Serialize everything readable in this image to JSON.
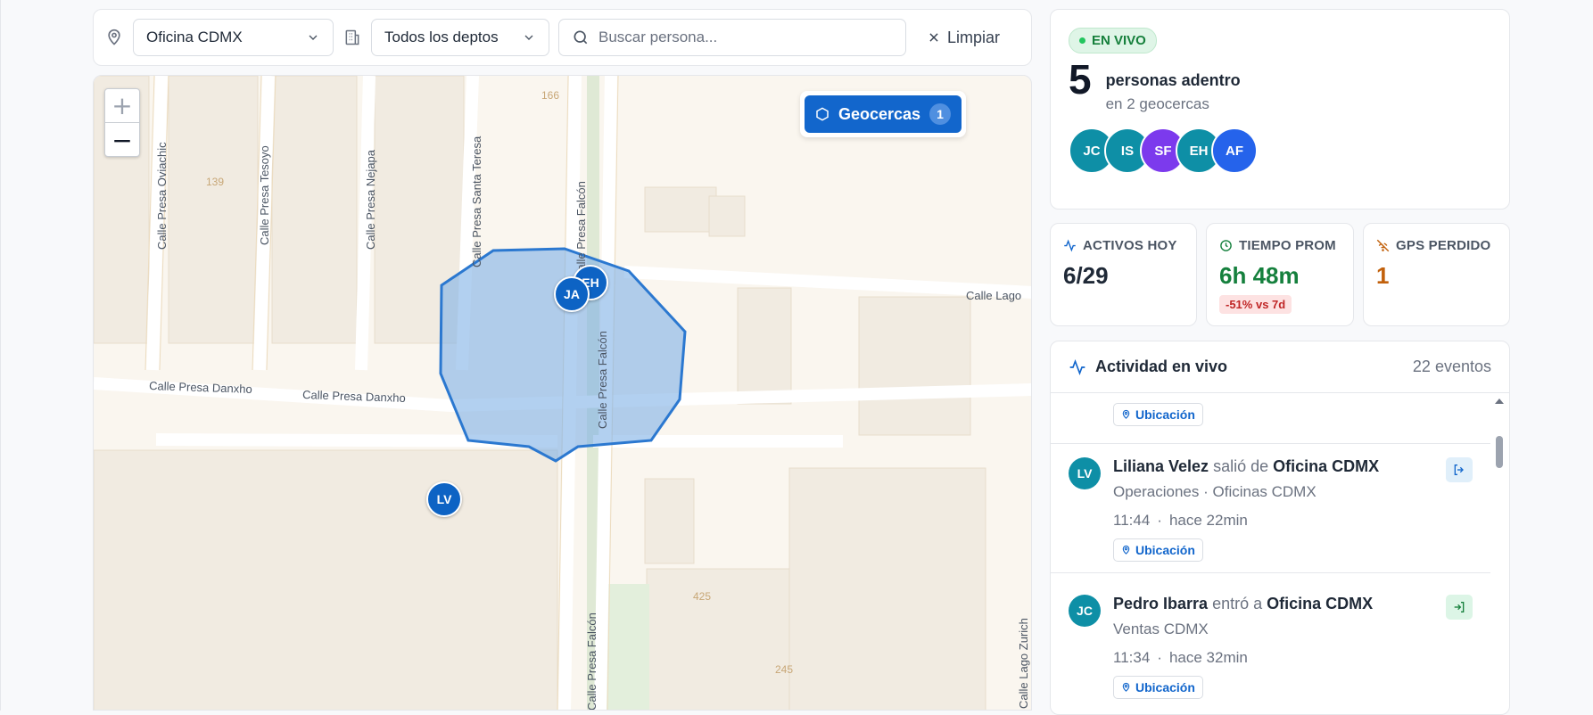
{
  "filters": {
    "location_select": "Oficina CDMX",
    "dept_select": "Todos los deptos",
    "search_placeholder": "Buscar persona...",
    "clear_label": "Limpiar"
  },
  "map": {
    "zoom_in": "+",
    "zoom_out": "−",
    "geofence_button": "Geocercas",
    "geofence_count": "1",
    "streets": [
      "Calle Presa Oviachic",
      "Calle Presa Tesoyo",
      "Calle Presa Nejapa",
      "Calle Presa Santa Teresa",
      "Calle Presa Falcón",
      "Calle Presa Falcón",
      "Calle Presa Falcón",
      "Calle Presa Danxho",
      "Calle Presa Danxho",
      "Calle Lago",
      "Calle Lago Zurich"
    ],
    "numbers": [
      "166",
      "139",
      "425",
      "245"
    ],
    "pins": [
      {
        "initials": "EH"
      },
      {
        "initials": "JA"
      },
      {
        "initials": "LV"
      }
    ]
  },
  "live": {
    "badge": "EN VIVO",
    "count": "5",
    "count_label": "personas adentro",
    "count_sub": "en 2 geocercas",
    "avatars": [
      {
        "initials": "JC",
        "color": "#0e8fa6"
      },
      {
        "initials": "IS",
        "color": "#0e8fa6"
      },
      {
        "initials": "SF",
        "color": "#7c3aed"
      },
      {
        "initials": "EH",
        "color": "#0e8fa6"
      },
      {
        "initials": "AF",
        "color": "#2563eb"
      }
    ]
  },
  "stats": {
    "active": {
      "label": "ACTIVOS HOY",
      "value": "6/29"
    },
    "time": {
      "label": "TIEMPO PROM",
      "value": "6h 48m",
      "chip": "-51% vs 7d"
    },
    "gps": {
      "label": "GPS PERDIDO",
      "value": "1"
    }
  },
  "activity": {
    "title": "Actividad en vivo",
    "count": "22 eventos",
    "top_chip": "Ubicación",
    "events": [
      {
        "initials": "LV",
        "name": "Liliana Velez",
        "verb": "salió de",
        "place": "Oficina CDMX",
        "sub": "Operaciones · Oficinas CDMX",
        "time": "11:44",
        "ago": "hace 22min",
        "chip": "Ubicación",
        "action": "exit"
      },
      {
        "initials": "JC",
        "name": "Pedro Ibarra",
        "verb": "entró a",
        "place": "Oficina CDMX",
        "sub": "Ventas CDMX",
        "time": "11:34",
        "ago": "hace 32min",
        "chip": "Ubicación",
        "action": "enter"
      }
    ]
  },
  "colors": {
    "accent": "#1266cc",
    "live_green": "#16803c",
    "time_green": "#15803d",
    "gps_orange": "#c2610c",
    "geofence_fill": "#7fb0e6"
  }
}
